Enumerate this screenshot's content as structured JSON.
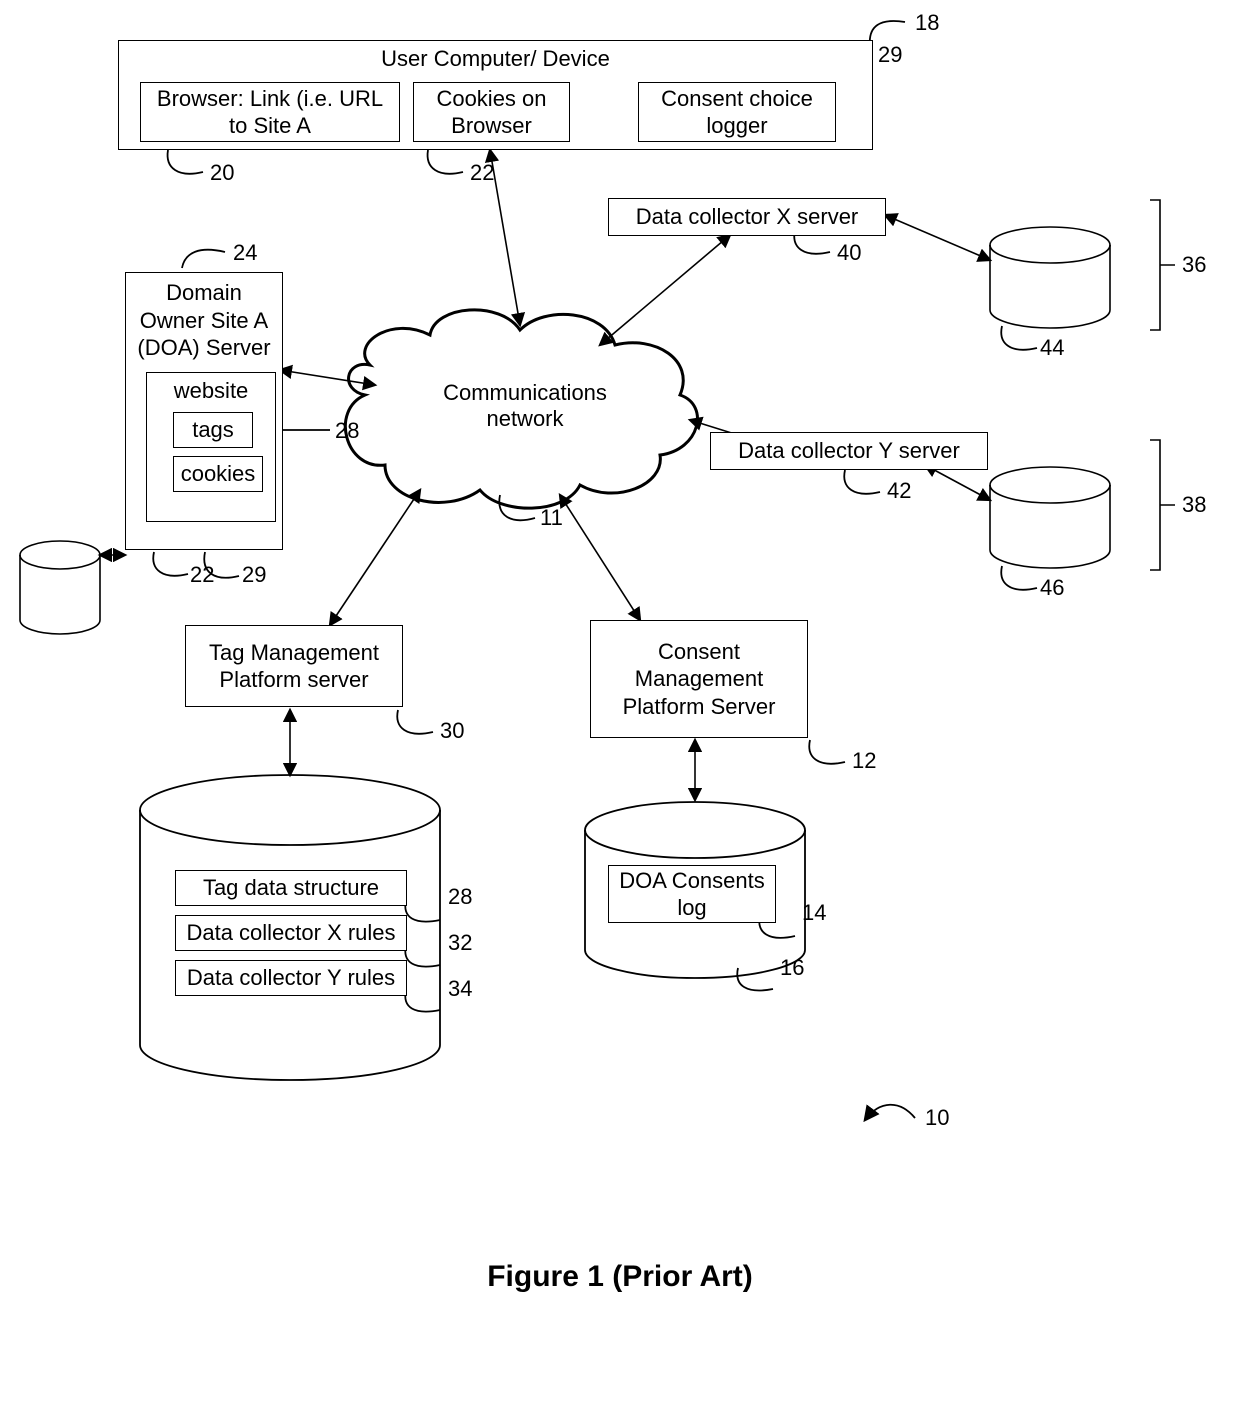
{
  "figure_caption": "Figure 1 (Prior Art)",
  "refs": {
    "r10": "10",
    "r11": "11",
    "r12": "12",
    "r14": "14",
    "r16": "16",
    "r18": "18",
    "r20": "20",
    "r22a": "22",
    "r22b": "22",
    "r24": "24",
    "r28a": "28",
    "r28b": "28",
    "r29a": "29",
    "r29b": "29",
    "r30": "30",
    "r32": "32",
    "r34": "34",
    "r36": "36",
    "r38": "38",
    "r40": "40",
    "r42": "42",
    "r44": "44",
    "r46": "46"
  },
  "blocks": {
    "user_computer": {
      "title": "User Computer/ Device"
    },
    "browser": {
      "text": "Browser: Link (i.e. URL to Site A"
    },
    "cookies_browser": {
      "text": "Cookies on Browser"
    },
    "consent_logger": {
      "text": "Consent choice logger"
    },
    "comms_network": {
      "text": "Communications network"
    },
    "doa_server": {
      "title": "Domain Owner Site A (DOA) Server"
    },
    "website": {
      "label": "website",
      "tags": "tags",
      "cookies": "cookies"
    },
    "data_x": {
      "text": "Data collector X server"
    },
    "data_y": {
      "text": "Data collector Y server"
    },
    "tmp": {
      "text": "Tag Management Platform server"
    },
    "cmp": {
      "text": "Consent Management Platform Server"
    },
    "tmp_db": {
      "tag_ds": "Tag data structure",
      "dcx_rules": "Data collector X rules",
      "dcy_rules": "Data collector Y rules"
    },
    "cmp_db": {
      "log": "DOA Consents log"
    }
  }
}
